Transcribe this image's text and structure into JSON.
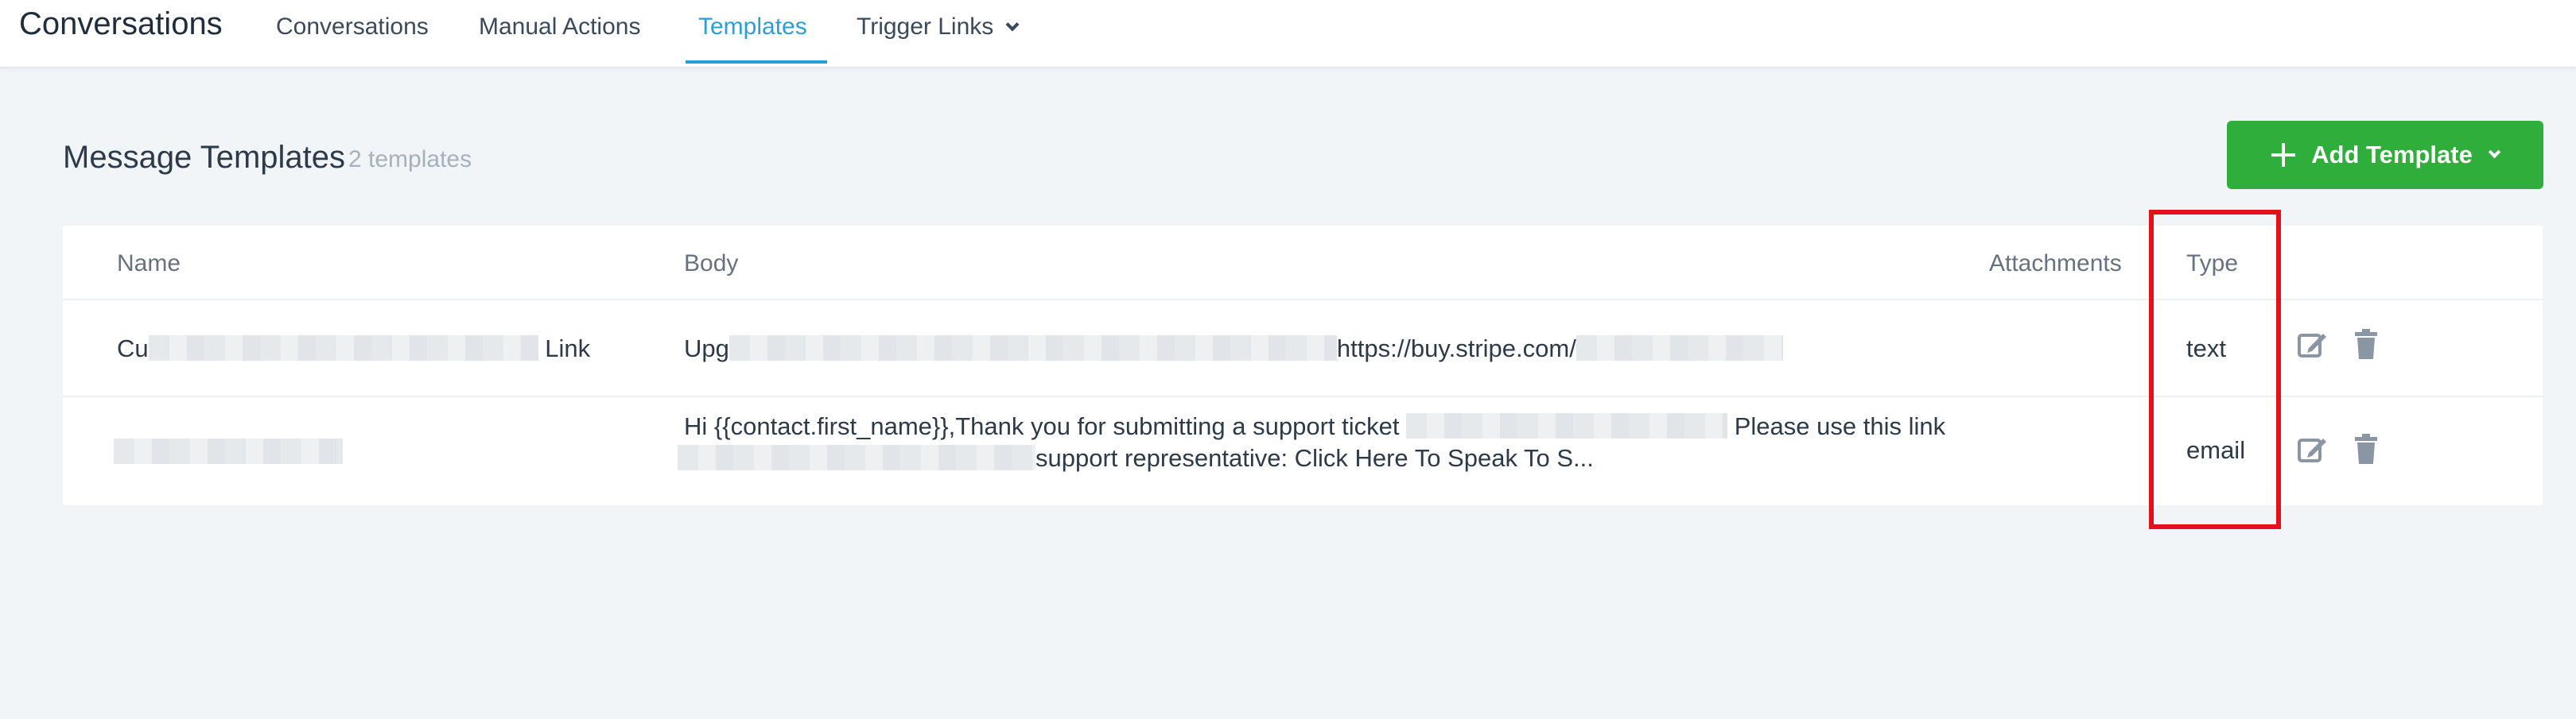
{
  "app": {
    "title": "Conversations"
  },
  "nav": {
    "tabs": [
      {
        "label": "Conversations",
        "active": false
      },
      {
        "label": "Manual Actions",
        "active": false
      },
      {
        "label": "Templates",
        "active": true
      },
      {
        "label": "Trigger Links",
        "active": false,
        "has_dropdown": true
      }
    ]
  },
  "page": {
    "title": "Message Templates",
    "count": "2 templates",
    "add_button": "Add Template"
  },
  "table": {
    "columns": [
      "Name",
      "Body",
      "Attachments",
      "Type"
    ],
    "rows": [
      {
        "name_start": "Cu",
        "name_end": "Link",
        "body_line1_start": "Upg",
        "body_line1_mid": "https://buy.stripe.com/",
        "type": "text"
      },
      {
        "body_line1": "Hi {{contact.first_name}},Thank you for submitting a support ticket",
        "body_line1_end": "Please use this link",
        "body_line2": "support representative: Click Here To Speak To S...",
        "type": "email"
      }
    ]
  },
  "colors": {
    "accent": "#2a9fd6",
    "primary_button": "#2fae3b",
    "highlight": "#e2121c"
  },
  "icons": [
    "edit-icon",
    "trash-icon",
    "plus-icon",
    "chevron-down-icon"
  ]
}
